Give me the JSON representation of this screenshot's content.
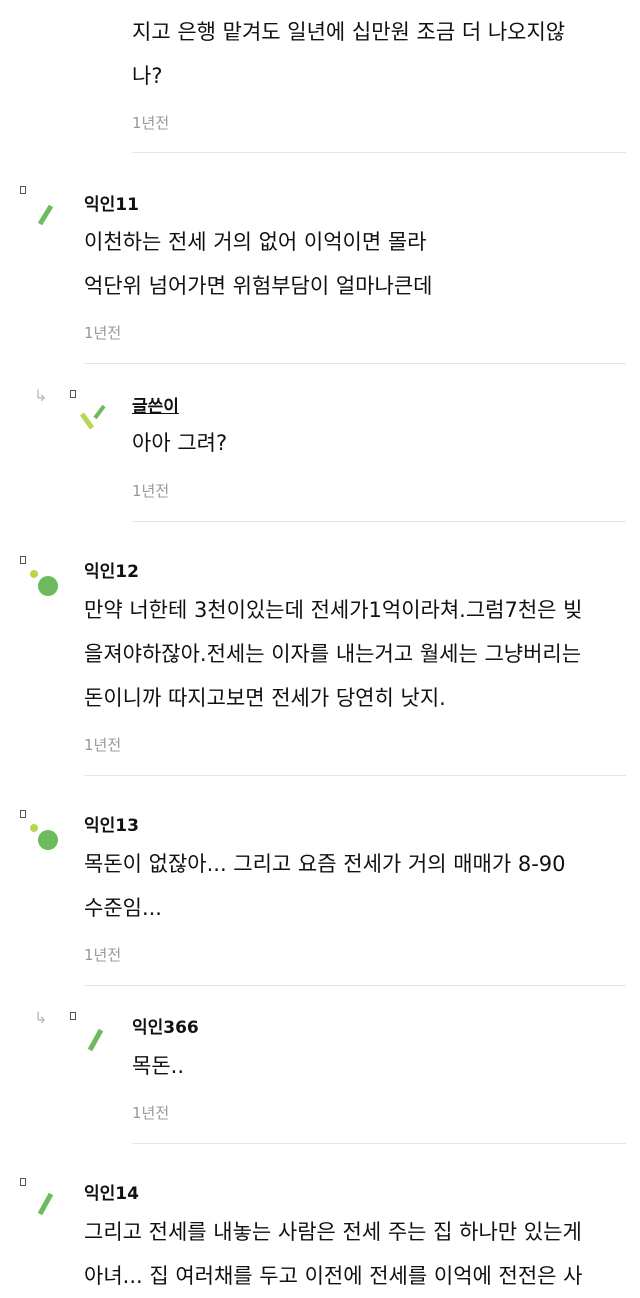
{
  "comments": [
    {
      "author": "",
      "lines": [
        "지고 은행 맡겨도 일년에 십만원 조금 더 나오지않",
        "나?"
      ],
      "time": "1년전"
    },
    {
      "author": "익인11",
      "lines": [
        "이천하는 전세 거의 없어 이억이면 몰라",
        "억단위 넘어가면 위험부담이 얼마나큰데"
      ],
      "time": "1년전"
    },
    {
      "author": "글쓴이",
      "lines": [
        "아아 그려?"
      ],
      "time": "1년전"
    },
    {
      "author": "익인12",
      "lines": [
        "만약 너한테 3천이있는데 전세가1억이라쳐.그럼7천은 빚",
        "을져야하잖아.전세는 이자를 내는거고 월세는 그냥버리는",
        "돈이니까 따지고보면 전세가 당연히 낫지."
      ],
      "time": "1년전"
    },
    {
      "author": "익인13",
      "lines": [
        "목돈이 없잖아... 그리고 요즘 전세가 거의 매매가 8-90",
        "수준임..."
      ],
      "time": "1년전"
    },
    {
      "author": "익인366",
      "lines": [
        "목돈.."
      ],
      "time": "1년전"
    },
    {
      "author": "익인14",
      "lines": [
        "그리고 전세를 내놓는 사람은 전세 주는 집 하나만 있는게",
        "아녀... 집 여러채를 두고 이전에 전세를 이억에 전전은 사"
      ],
      "time": ""
    }
  ],
  "reply_arrow": "↳",
  "icons": {
    "reply": "reply-arrow-icon",
    "avatar": "anonymous-avatar-icon"
  },
  "colors": {
    "avatar_green": "#6dbb5e",
    "avatar_lime": "#b6d84a",
    "divider": "#e6e6e6",
    "time": "#999999"
  }
}
